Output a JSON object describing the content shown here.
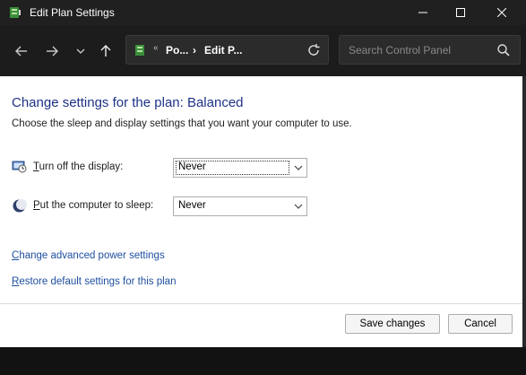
{
  "window": {
    "title": "Edit Plan Settings",
    "minimize_icon": "minimize-icon",
    "maximize_icon": "maximize-icon",
    "close_icon": "close-icon"
  },
  "nav": {
    "back_icon": "arrow-left-icon",
    "forward_icon": "arrow-right-icon",
    "recent_icon": "chevron-down-icon",
    "up_icon": "arrow-up-icon",
    "address": {
      "overflow": "«",
      "crumb1": "Po...",
      "sep": "›",
      "crumb2": "Edit P..."
    },
    "search_placeholder": "Search Control Panel"
  },
  "main": {
    "heading": "Change settings for the plan: Balanced",
    "subtext": "Choose the sleep and display settings that you want your computer to use.",
    "display": {
      "label_prefix": "T",
      "label_rest": "urn off the display:",
      "value": "Never"
    },
    "sleep": {
      "label_prefix": "P",
      "label_rest": "ut the computer to sleep:",
      "value": "Never"
    },
    "links": {
      "advanced_u": "C",
      "advanced_rest": "hange advanced power settings",
      "restore_u": "R",
      "restore_rest": "estore default settings for this plan"
    }
  },
  "footer": {
    "save": "Save changes",
    "cancel": "Cancel"
  },
  "colors": {
    "heading": "#1e3287",
    "link": "#1e4fa0",
    "titlebar": "#202020",
    "navbar": "#1c1c1c"
  }
}
